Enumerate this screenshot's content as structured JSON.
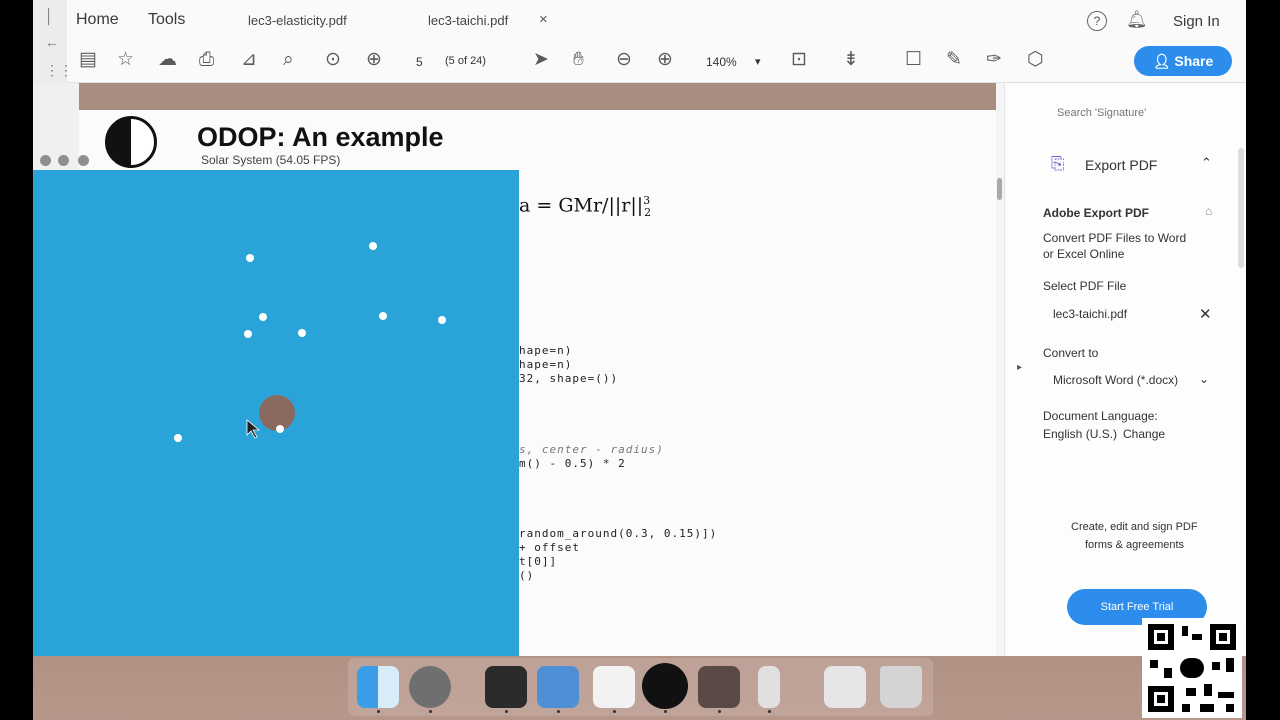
{
  "menubar": {
    "home": "Home",
    "tools": "Tools",
    "tabs": [
      {
        "label": "lec3-elasticity.pdf"
      },
      {
        "label": "lec3-taichi.pdf"
      }
    ],
    "tab_close": "×",
    "help": "?",
    "sign_in": "Sign In"
  },
  "toolbar": {
    "page_number": "5",
    "page_count": "(5 of 24)",
    "zoom": "140%"
  },
  "share": {
    "label": "Share"
  },
  "slide": {
    "title": "ODOP: An example",
    "formula": "a = GMr/||r||",
    "formula_sup": "3",
    "formula_sub": "2",
    "code": [
      "hape=n)",
      "hape=n)",
      "32, shape=())",
      "s, center - radius)",
      "m() - 0.5) * 2",
      "random_around(0.3, 0.15)])",
      "+ offset",
      "t[0]]",
      "()"
    ]
  },
  "right_pane": {
    "search": "Search 'Signature'",
    "export_title": "Export PDF",
    "adobe_export": "Adobe Export PDF",
    "description_line1": "Convert PDF Files to Word",
    "description_line2": "or Excel Online",
    "select_file_label": "Select PDF File",
    "selected_file": "lec3-taichi.pdf",
    "convert_to_label": "Convert to",
    "convert_to_value": "Microsoft Word (*.docx)",
    "doc_lang_label": "Document Language:",
    "doc_lang_value": "English (U.S.)",
    "change": "Change",
    "promo_line1": "Create, edit and sign PDF",
    "promo_line2": "forms & agreements",
    "trial_button": "Start Free Trial"
  },
  "simulation": {
    "title": "Solar System (54.05 FPS)",
    "background_color": "#2aa3d8",
    "sun_color": "#8a6a5f",
    "planet_color": "#ffffff"
  },
  "dock": {
    "apps": [
      "finder-icon",
      "browser-icon",
      "terminal-icon",
      "keynote-icon",
      "preview-icon",
      "obs-icon",
      "acrobat-icon",
      "dropper-icon",
      "scanner-icon",
      "trash-icon"
    ]
  }
}
